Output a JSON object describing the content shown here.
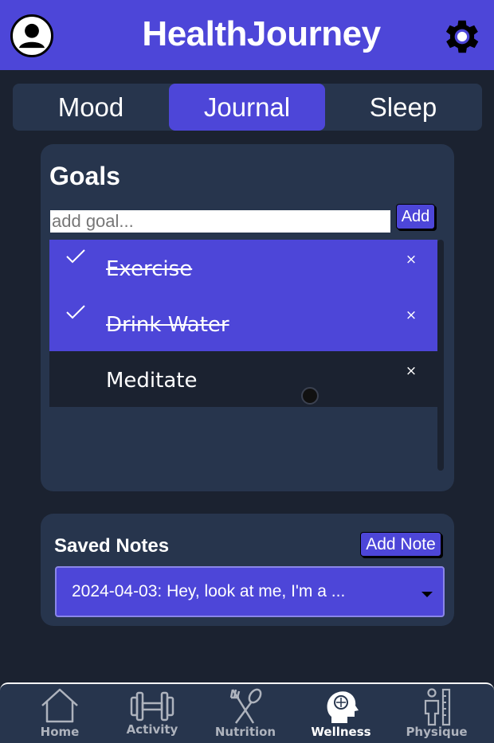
{
  "header": {
    "title": "HealthJourney",
    "profile_icon": "user-circle-icon",
    "settings_icon": "gear-icon"
  },
  "tabs": [
    {
      "label": "Mood",
      "active": false
    },
    {
      "label": "Journal",
      "active": true
    },
    {
      "label": "Sleep",
      "active": false
    }
  ],
  "goals": {
    "title": "Goals",
    "input_placeholder": "add goal...",
    "input_value": "",
    "add_label": "Add",
    "items": [
      {
        "text": "Exercise",
        "done": true
      },
      {
        "text": "Drink Water",
        "done": true
      },
      {
        "text": "Meditate",
        "done": false
      }
    ],
    "remove_symbol": "×"
  },
  "notes": {
    "title": "Saved Notes",
    "add_label": "Add Note",
    "selected": "2024-04-03: Hey, look at me, I'm a ..."
  },
  "bottom_nav": [
    {
      "label": "Home",
      "icon": "home-icon",
      "active": false
    },
    {
      "label": "Activity",
      "icon": "dumbbell-icon",
      "active": false
    },
    {
      "label": "Nutrition",
      "icon": "fork-spoon-icon",
      "active": false
    },
    {
      "label": "Wellness",
      "icon": "brain-head-icon",
      "active": true
    },
    {
      "label": "Physique",
      "icon": "body-measure-icon",
      "active": false
    }
  ],
  "colors": {
    "accent": "#4d46d8",
    "background": "#1b2230",
    "card": "#27354d"
  }
}
